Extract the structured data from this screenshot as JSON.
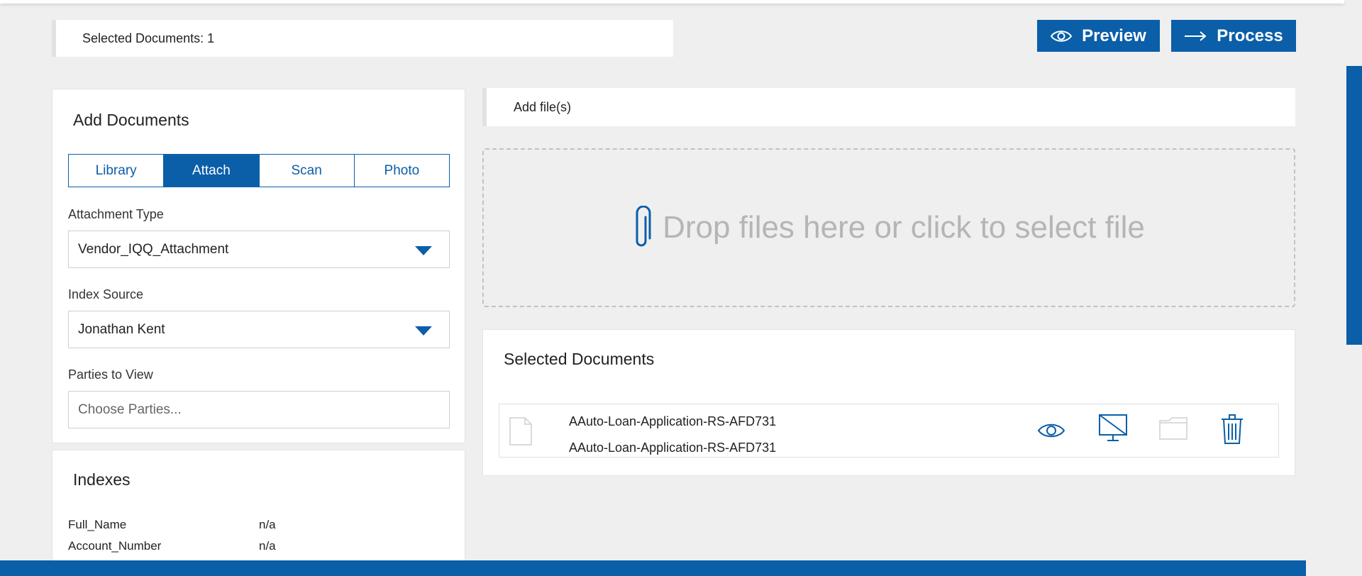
{
  "header": {
    "selected_count": "Selected Documents: 1",
    "preview_label": "Preview",
    "process_label": "Process"
  },
  "add_documents": {
    "title": "Add Documents",
    "tabs": [
      "Library",
      "Attach",
      "Scan",
      "Photo"
    ],
    "active_tab": "Attach",
    "attachment_type_label": "Attachment Type",
    "attachment_type_value": "Vendor_IQQ_Attachment",
    "index_source_label": "Index Source",
    "index_source_value": "Jonathan Kent",
    "parties_label": "Parties to View",
    "parties_placeholder": "Choose Parties..."
  },
  "indexes": {
    "title": "Indexes",
    "rows": [
      {
        "key": "Full_Name",
        "value": "n/a"
      },
      {
        "key": "Account_Number",
        "value": "n/a"
      }
    ]
  },
  "upload": {
    "add_files_label": "Add file(s)",
    "dropzone_text": "Drop files here or click to select file"
  },
  "selected_documents": {
    "title": "Selected Documents",
    "items": [
      {
        "name": "AAuto-Loan-Application-RS-AFD731",
        "subname": "AAuto-Loan-Application-RS-AFD731"
      }
    ],
    "actions": [
      "eye-icon",
      "monitor-off-icon",
      "folder-icon",
      "trash-icon"
    ]
  },
  "colors": {
    "primary": "#0b5ea8",
    "background": "#efefef",
    "dropzone_text": "#b5b5b5"
  }
}
